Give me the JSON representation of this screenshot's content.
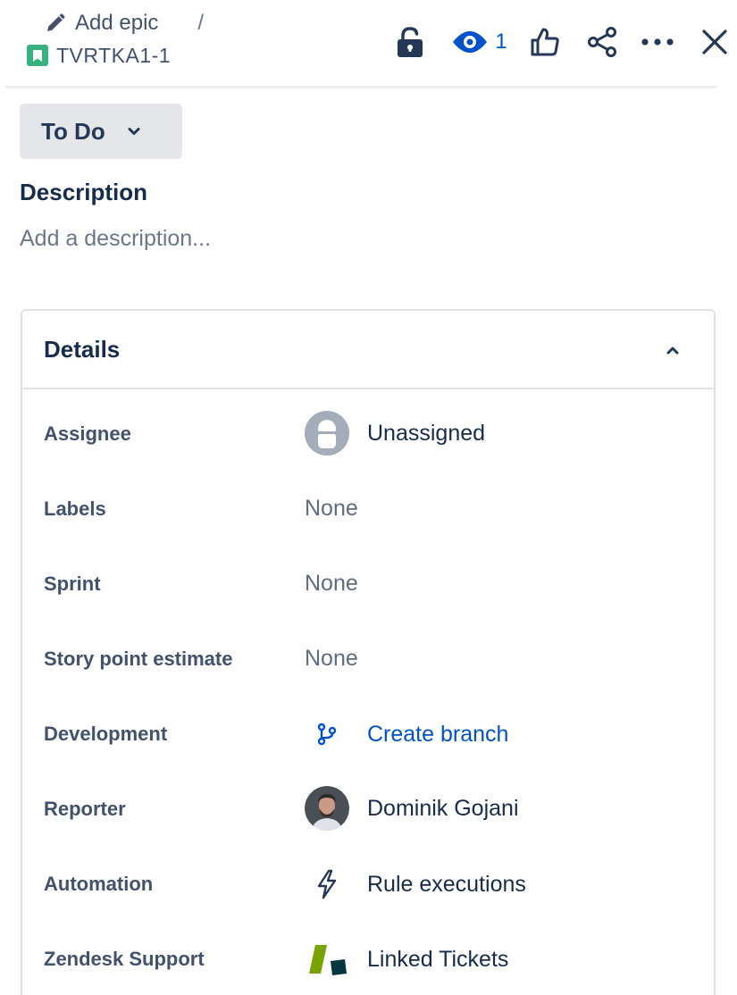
{
  "breadcrumb": {
    "add_epic_label": "Add epic",
    "separator": "/",
    "issue_key": "TVRTKA1-1"
  },
  "toolbar": {
    "watchers_count": "1"
  },
  "status": {
    "label": "To Do"
  },
  "description": {
    "title": "Description",
    "placeholder": "Add a description..."
  },
  "details": {
    "title": "Details",
    "fields": {
      "assignee": {
        "label": "Assignee",
        "value": "Unassigned"
      },
      "labels": {
        "label": "Labels",
        "value": "None"
      },
      "sprint": {
        "label": "Sprint",
        "value": "None"
      },
      "story_points": {
        "label": "Story point estimate",
        "value": "None"
      },
      "development": {
        "label": "Development",
        "value": "Create branch"
      },
      "reporter": {
        "label": "Reporter",
        "value": "Dominik Gojani"
      },
      "automation": {
        "label": "Automation",
        "value": "Rule executions"
      },
      "zendesk": {
        "label": "Zendesk Support",
        "value": "Linked Tickets"
      }
    }
  },
  "icons": {
    "breadcrumb": [
      "pencil-icon",
      "story-icon"
    ],
    "toolbar": [
      "lock-icon",
      "eye-icon",
      "thumbs-up-icon",
      "share-icon",
      "more-icon",
      "close-icon"
    ],
    "fields": [
      "user-avatar-icon",
      "branch-icon",
      "lightning-icon",
      "zendesk-icon"
    ]
  },
  "colors": {
    "accent": "#0052cc",
    "story": "#36b37e",
    "text": "#172b4d",
    "muted": "#6b778c",
    "status_bg": "#e4e6ea",
    "border": "#dfe1e6",
    "zendesk_green": "#78a300",
    "zendesk_dark": "#03363d"
  }
}
